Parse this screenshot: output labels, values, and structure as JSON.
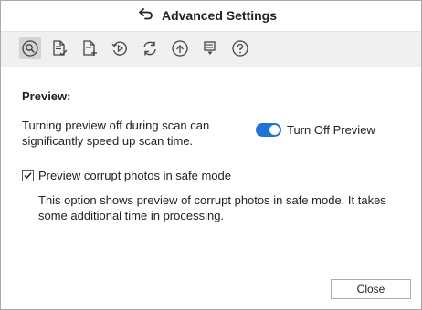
{
  "window": {
    "title": "Advanced Settings"
  },
  "toolbar": {
    "icons": [
      "preview-icon",
      "file-check-icon",
      "file-add-icon",
      "resume-recovery-icon",
      "update-icon",
      "upload-icon",
      "flag-icon",
      "help-icon"
    ]
  },
  "preview": {
    "heading": "Preview:",
    "description": "Turning preview off during scan can significantly speed up scan time.",
    "toggle_label": "Turn Off Preview",
    "toggle_on": true
  },
  "safe_mode": {
    "checkbox_label": "Preview corrupt photos in safe mode",
    "checked": true,
    "info": "This option shows preview of corrupt photos in safe mode. It takes some additional time in processing."
  },
  "footer": {
    "close_label": "Close"
  },
  "colors": {
    "accent": "#1f74d6",
    "toolbar_bg": "#f0f0f0"
  }
}
